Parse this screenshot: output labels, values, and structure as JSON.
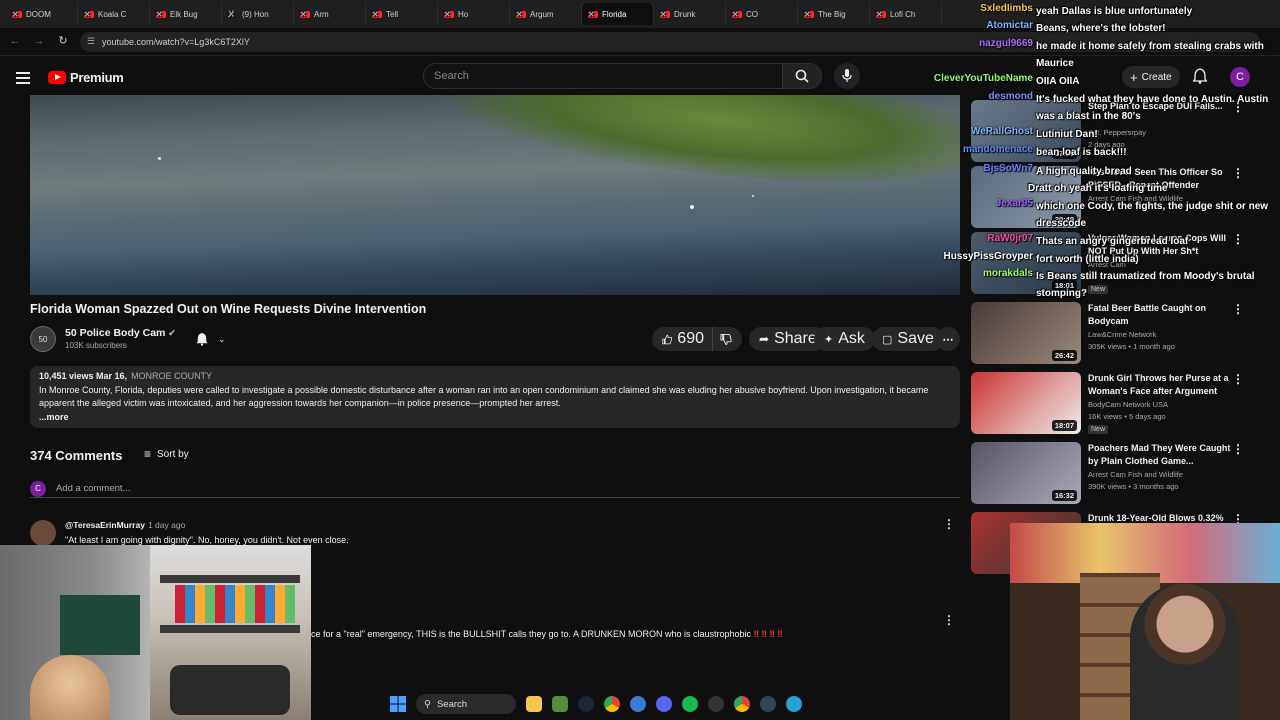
{
  "browser": {
    "tabs": [
      {
        "label": "DOOM",
        "icon": "youtube-icon"
      },
      {
        "label": "Koala C",
        "icon": "youtube-icon"
      },
      {
        "label": "Elk Bug",
        "icon": "youtube-icon"
      },
      {
        "label": "(9) Hon",
        "icon": "x-icon"
      },
      {
        "label": "Arm",
        "icon": "youtube-icon"
      },
      {
        "label": "Tell",
        "icon": "youtube-icon"
      },
      {
        "label": "Ho",
        "icon": "youtube-icon"
      },
      {
        "label": "Argum",
        "icon": "youtube-icon"
      },
      {
        "label": "Florida",
        "icon": "youtube-icon",
        "active": true
      },
      {
        "label": "Drunk",
        "icon": "youtube-icon"
      },
      {
        "label": "CO",
        "icon": "youtube-icon"
      },
      {
        "label": "The Big",
        "icon": "youtube-icon"
      },
      {
        "label": "Lofi Ch",
        "icon": "youtube-icon"
      }
    ],
    "url": "youtube.com/watch?v=Lg3kC6T2XlY"
  },
  "header": {
    "logo_text": "Premium",
    "search_placeholder": "Search",
    "create_label": "Create",
    "avatar_letter": "C"
  },
  "video": {
    "title": "Florida Woman Spazzed Out on Wine Requests Divine Intervention",
    "channel": "50 Police Body Cam",
    "channel_avatar": "50",
    "subscribers": "103K subscribers",
    "likes": "690",
    "share_label": "Share",
    "ask_label": "Ask",
    "save_label": "Save",
    "views_date": "10,451 views  Mar 16,",
    "location_tag": "MONROE COUNTY",
    "description": "In Monroe County, Florida, deputies were called to investigate a possible domestic disturbance after a woman ran into an open condominium and claimed she was eluding her abusive boyfriend. Upon investigation, it became apparent the alleged victim was intoxicated, and her aggression towards her companion—in police presence—prompted her arrest.",
    "more_label": "...more"
  },
  "comments": {
    "count_label": "374 Comments",
    "sort_label": "Sort by",
    "add_placeholder": "Add a comment...",
    "user_avatar_letter": "C",
    "items": [
      {
        "handle": "@TeresaErinMurray",
        "time": "1 day ago",
        "text": "\"At least I am going with dignity\". No, honey, you didn't.  Not even close."
      },
      {
        "text": "ce for a \"real\" emergency, THIS is the BULLSHIT calls they go to. A DRUNKEN MORON who is claustrophobic",
        "bangs": "‼ ‼ ‼ ‼"
      }
    ]
  },
  "recommendations": [
    {
      "title": "Step Plan to Escape DUI Fails...",
      "channel": "Sgt. Peppersrpay",
      "views": "2 days ago",
      "duration": "17:35"
    },
    {
      "title": "Has Never Seen This Officer So PISSED - Repeat Offender",
      "channel": "Arrest Cam Fish and Wildlife",
      "views": "",
      "duration": "30:49"
    },
    {
      "title": "Vulgar Woman Learns Cops Will NOT Put Up With Her Sh*t",
      "channel": "Arrest Cam",
      "views": "",
      "duration": "18:01",
      "badge": "New"
    },
    {
      "title": "Fatal Beer Battle Caught on Bodycam",
      "channel": "Law&Crime Network",
      "views": "305K views • 1 month ago",
      "duration": "26:42"
    },
    {
      "title": "Drunk Girl Throws her Purse at a Woman's Face after Argument",
      "channel": "BodyCam Network USA",
      "views": "16K views • 5 days ago",
      "duration": "18:07",
      "badge": "New"
    },
    {
      "title": "Poachers Mad They Were Caught by Plain Clothed Game...",
      "channel": "Arrest Cam Fish and Wildlife",
      "views": "390K views • 3 months ago",
      "duration": "16:32"
    },
    {
      "title": "Drunk 18-Year-Old Blows 0.32%",
      "channel": "",
      "views": "",
      "duration": ""
    }
  ],
  "chat": [
    {
      "user": "SxledIimbs",
      "color": "#f2c94c",
      "msg": "yeah Dallas is blue unfortunately"
    },
    {
      "user": "Atomictar",
      "color": "#7fb3ff",
      "msg": "Beans, where's the lobster!"
    },
    {
      "user": "nazgul9669",
      "color": "#b06cff",
      "msg": "he made it home safely from stealing crabs with Maurice"
    },
    {
      "user": "CleverYouTubeName",
      "color": "#8fff6b",
      "msg": "OIIA OIIA"
    },
    {
      "user": "desmond",
      "color": "#7a8cff",
      "msg": "It's fucked what they have done to Austin. Austin was a blast in the 80's"
    },
    {
      "user": "WeRallGhost",
      "color": "#7fb3ff",
      "msg": "Lutiniut Dan!"
    },
    {
      "user": "mandomenace",
      "color": "#5b8cff",
      "msg": "bean loaf is back!!!"
    },
    {
      "user": "BjsSoWn7",
      "color": "#6b7bff",
      "msg": "A high quality bread"
    },
    {
      "user": "",
      "color": "#ffffff",
      "msg": "Dratt oh yeah it's loafing time"
    },
    {
      "user": "Jexar95",
      "color": "#9b5cff",
      "msg": "which one Cody, the fights, the judge shit or new dresscode"
    },
    {
      "user": "RaW0jr07",
      "color": "#ff4a9c",
      "msg": "Thats an angry gingerbread loaf"
    },
    {
      "user": "HussyPissGroyper",
      "color": "#ffffff",
      "msg": "fort worth (little india)"
    },
    {
      "user": "morakdals",
      "color": "#9bff6b",
      "msg": "Is Beans still traumatized from Moody's brutal stomping?"
    }
  ],
  "taskbar": {
    "search_label": "Search"
  }
}
